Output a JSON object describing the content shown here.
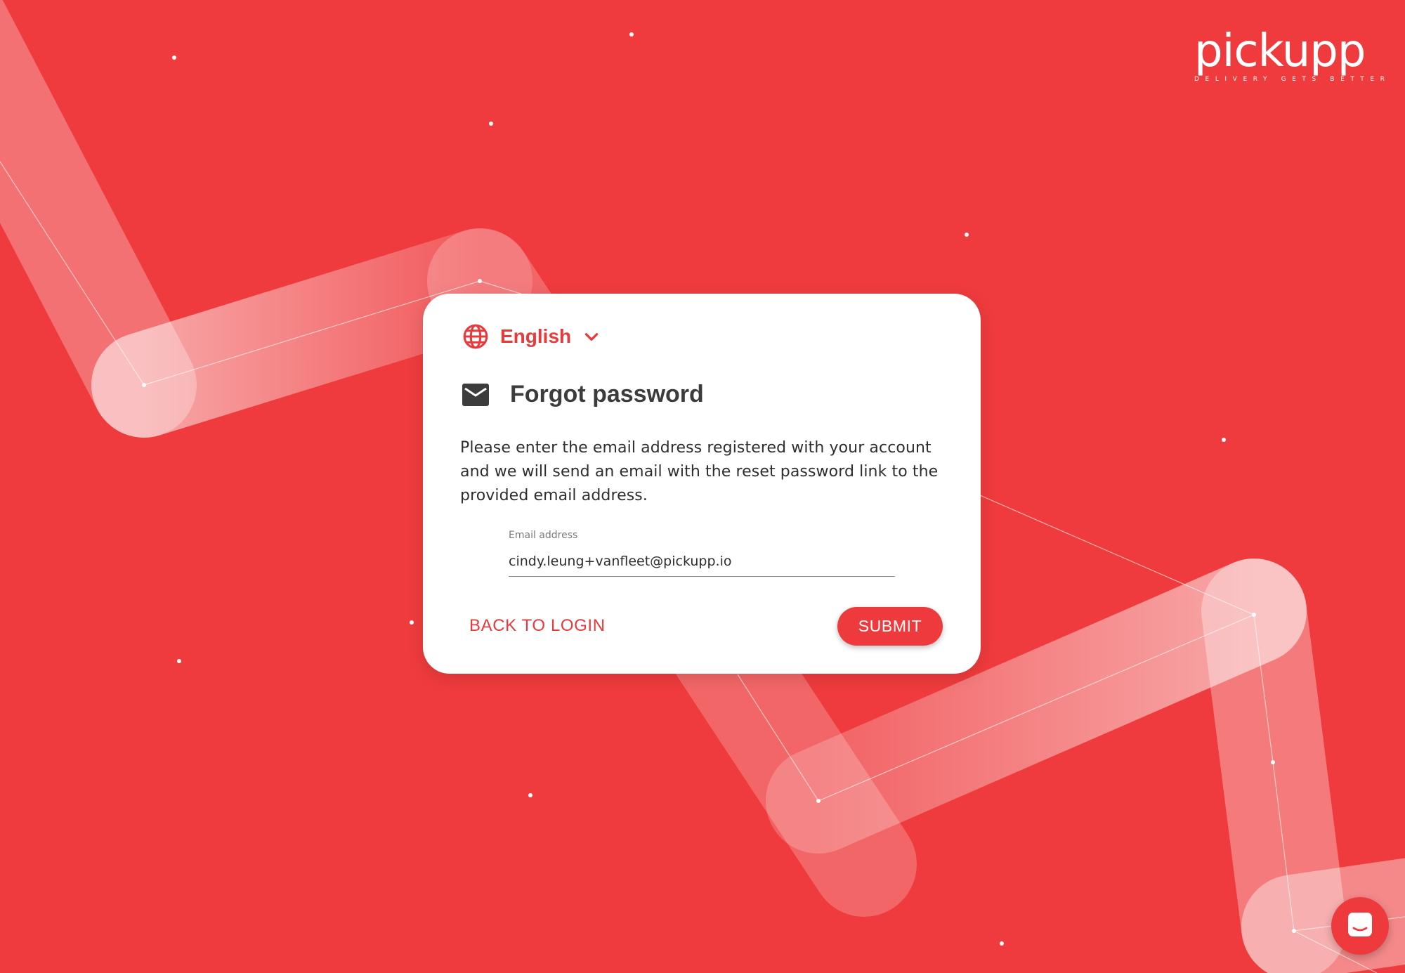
{
  "brand": {
    "name": "pickupp",
    "tagline": "DELIVERY GETS BETTER"
  },
  "colors": {
    "background": "#ef3b3d",
    "accent": "#e8393b",
    "card": "#ffffff"
  },
  "language": {
    "icon": "globe-icon",
    "selected": "English",
    "toggle_icon": "chevron-down-icon"
  },
  "form": {
    "icon": "mail-icon",
    "title": "Forgot password",
    "description": "Please enter the email address registered with your account and we will send an email with the reset password link to the provided email address.",
    "email": {
      "label": "Email address",
      "value": "cindy.leung+vanfleet@pickupp.io"
    },
    "back_label": "BACK TO LOGIN",
    "submit_label": "SUBMIT"
  },
  "chat": {
    "icon": "chat-icon"
  }
}
